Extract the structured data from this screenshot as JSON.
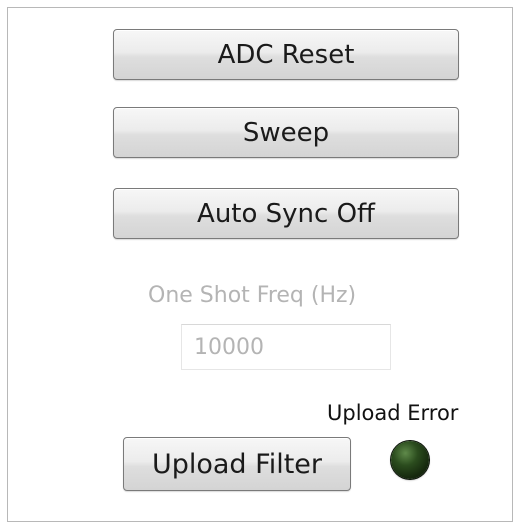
{
  "buttons": {
    "adc_reset": "ADC Reset",
    "sweep": "Sweep",
    "auto_sync": "Auto Sync Off",
    "upload_filter": "Upload Filter"
  },
  "one_shot": {
    "label": "One Shot Freq (Hz)",
    "value": "10000",
    "disabled": true
  },
  "upload_error": {
    "label": "Upload Error",
    "state": "off",
    "led_color": "#1e3a14"
  },
  "colors": {
    "disabled_text": "#b4b4b4",
    "button_border": "#7a7a7a"
  }
}
